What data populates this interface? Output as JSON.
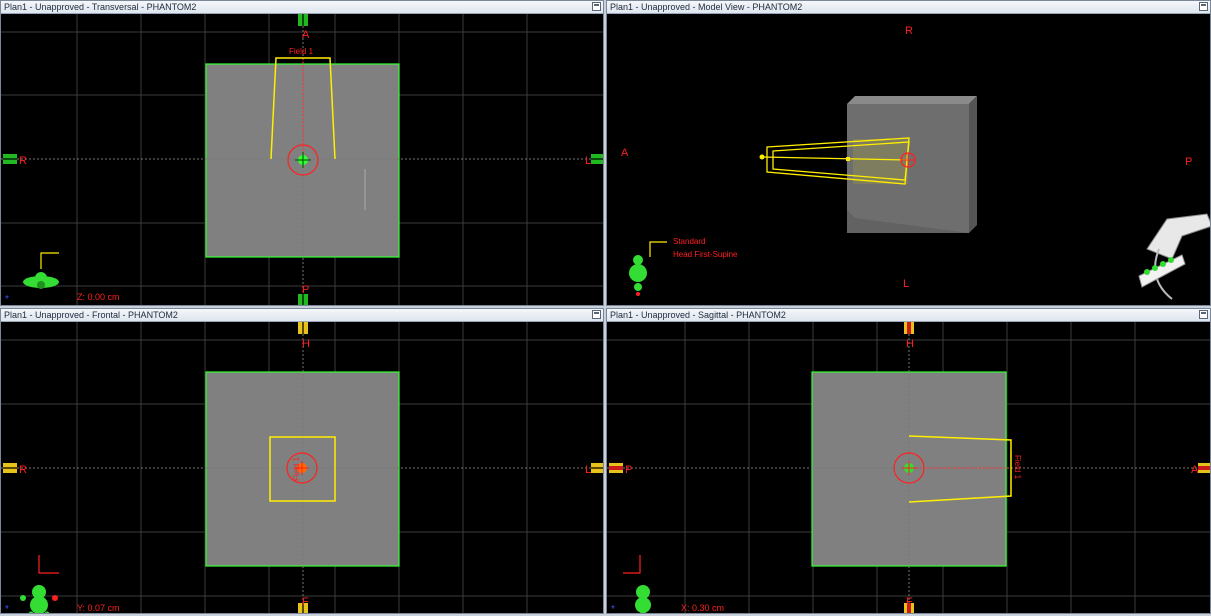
{
  "panes": {
    "transversal": {
      "title": "Plan1  -  Unapproved - Transversal - PHANTOM2",
      "top": "A",
      "bottom": "P",
      "left": "R",
      "right": "L",
      "field": "Field 1",
      "coord": "Z: 0.00 cm"
    },
    "model": {
      "title": "Plan1  -  Unapproved - Model View - PHANTOM2",
      "top": "R",
      "bottom": "L",
      "left": "A",
      "right": "P",
      "orientation_line1": "Standard",
      "orientation_line2": "Head First-Supine"
    },
    "frontal": {
      "title": "Plan1  -  Unapproved - Frontal - PHANTOM2",
      "top": "H",
      "bottom": "F",
      "left": "R",
      "right": "L",
      "field": "Field 1",
      "coord": "Y: 0.07 cm"
    },
    "sagittal": {
      "title": "Plan1  -  Unapproved - Sagittal - PHANTOM2",
      "top": "H",
      "bottom": "F",
      "left": "P",
      "right": "A",
      "field": "Field 1",
      "coord": "X: 0.30 cm"
    }
  },
  "colors": {
    "phantom": "#808080",
    "contour": "#33ff33",
    "beam": "#ffee00",
    "label": "#ff2020",
    "grid": "#3c3c3c"
  }
}
